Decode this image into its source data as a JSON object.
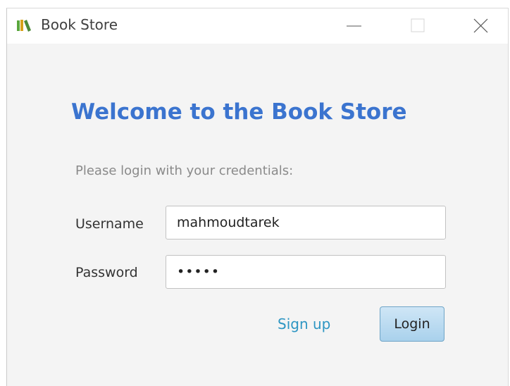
{
  "window": {
    "title": "Book Store",
    "controls": [
      "minimize-icon",
      "maximize-icon",
      "close-icon"
    ]
  },
  "login": {
    "heading": "Welcome to the Book Store",
    "subheading": "Please login with your credentials:",
    "username_label": "Username",
    "username_value": "mahmoudtarek",
    "password_label": "Password",
    "password_value": "•••••",
    "signup_link": "Sign up",
    "login_button": "Login"
  },
  "colors": {
    "heading": "#3b74cf",
    "link": "#2e96c3",
    "button": "#a9d1ec"
  }
}
